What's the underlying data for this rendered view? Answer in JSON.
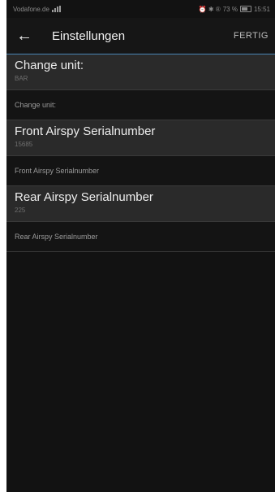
{
  "status": {
    "carrier": "Vodafone.de",
    "right_icons": "⏰ ✱ ®",
    "battery_pct": "73 %",
    "time": "15:51"
  },
  "appbar": {
    "title": "Einstellungen",
    "done_label": "FERTIG"
  },
  "sections": [
    {
      "pref_title": "Change unit:",
      "pref_value": "BAR",
      "category": "Change unit:"
    },
    {
      "pref_title": "Front Airspy Serialnumber",
      "pref_value": "15685",
      "category": "Front Airspy Serialnumber"
    },
    {
      "pref_title": "Rear Airspy Serialnumber",
      "pref_value": "225",
      "category": "Rear Airspy Serialnumber"
    }
  ]
}
